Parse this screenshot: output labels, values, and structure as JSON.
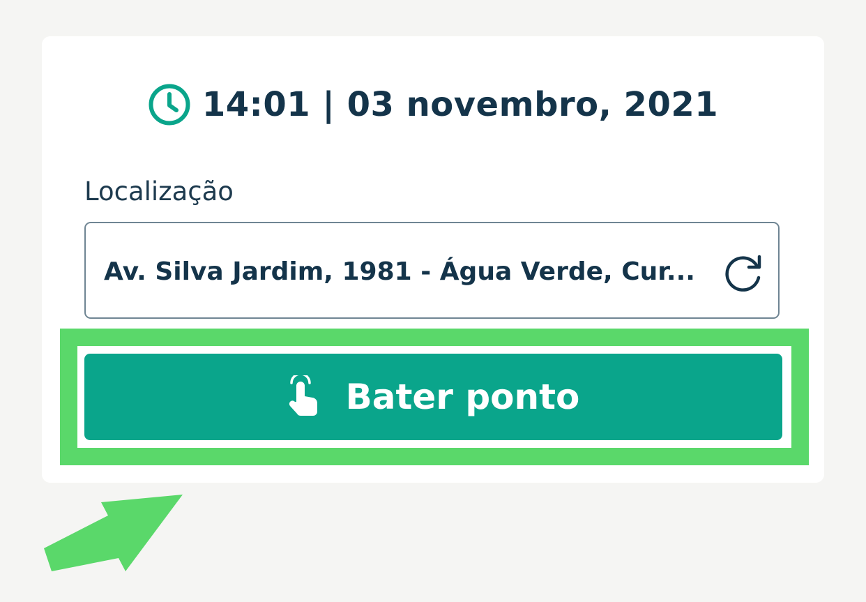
{
  "header": {
    "datetime": "14:01 | 03 novembro, 2021",
    "icon": "clock-icon"
  },
  "location": {
    "label": "Localização",
    "address": "Av. Silva Jardim, 1981 - Água Verde, Cur...",
    "refresh_icon": "refresh-icon"
  },
  "action": {
    "button_label": "Bater ponto",
    "icon": "tap-finger-icon"
  },
  "colors": {
    "accent": "#0aa58b",
    "text": "#14344a",
    "highlight": "#5ad86a",
    "background": "#f5f5f3"
  }
}
